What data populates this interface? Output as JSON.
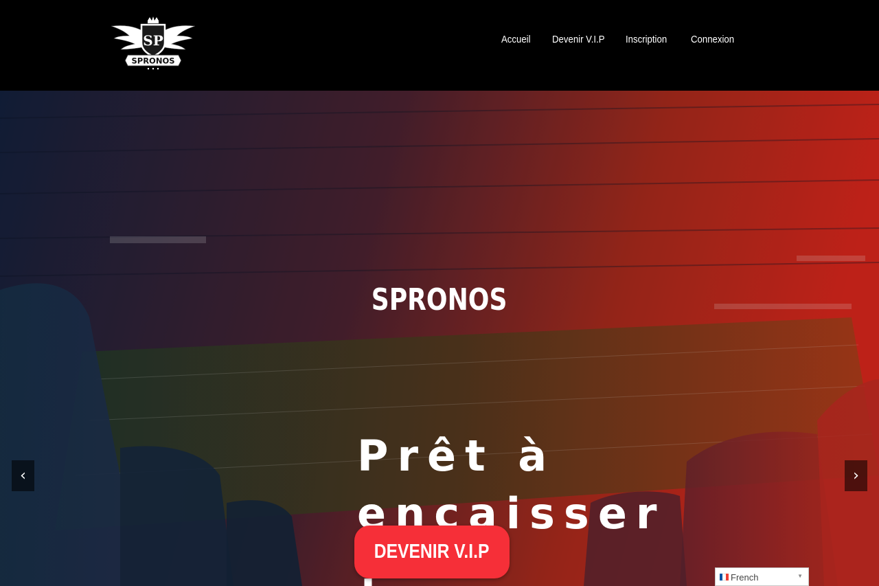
{
  "header": {
    "logo_text": "SPRONOS",
    "logo_monogram": "SP",
    "nav": [
      {
        "label": "Accueil"
      },
      {
        "label": "Devenir V.I.P"
      },
      {
        "label": "Inscription"
      },
      {
        "label": "Connexion"
      }
    ]
  },
  "hero": {
    "brand": "SPRONOS",
    "title_line1": "Prêt à",
    "title_line2": "encaisser ?",
    "cta_label": "DEVENIR V.I.P",
    "prev_icon": "chevron-left-icon",
    "next_icon": "chevron-right-icon",
    "prev_glyph": "‹",
    "next_glyph": "›"
  },
  "language_selector": {
    "selected": "French",
    "flag": "france-flag-icon"
  },
  "colors": {
    "accent": "#f62f38",
    "overlay_left": "#1b2a4f",
    "overlay_right": "#d8261c"
  }
}
